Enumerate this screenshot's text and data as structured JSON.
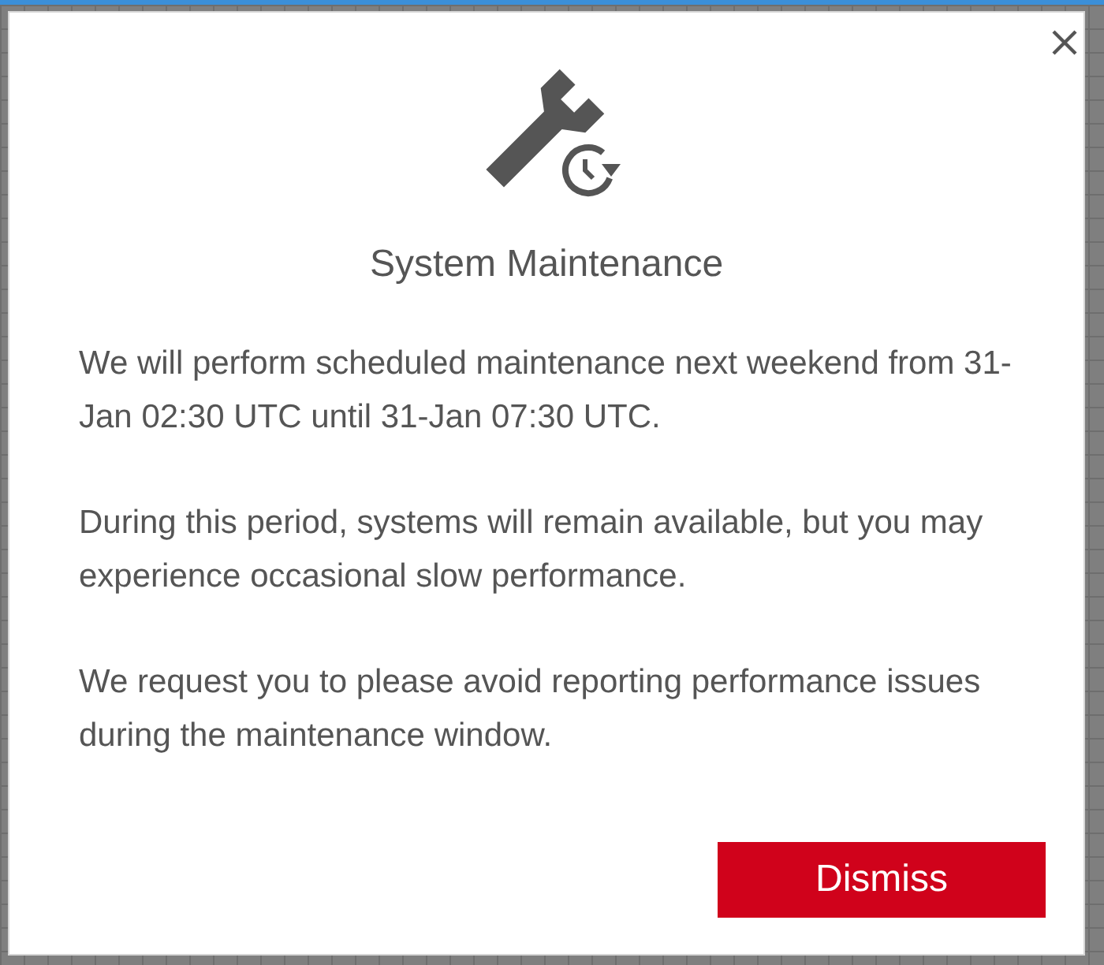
{
  "dialog": {
    "title": "System Maintenance",
    "paragraphs": [
      "We will perform scheduled maintenance next weekend from 31-Jan 02:30 UTC until 31-Jan 07:30 UTC.",
      "During this period, systems will remain available, but you may experience occasional slow performance.",
      "We request you to please avoid reporting performance issues during the maintenance window."
    ],
    "dismiss_button": "Dismiss"
  }
}
